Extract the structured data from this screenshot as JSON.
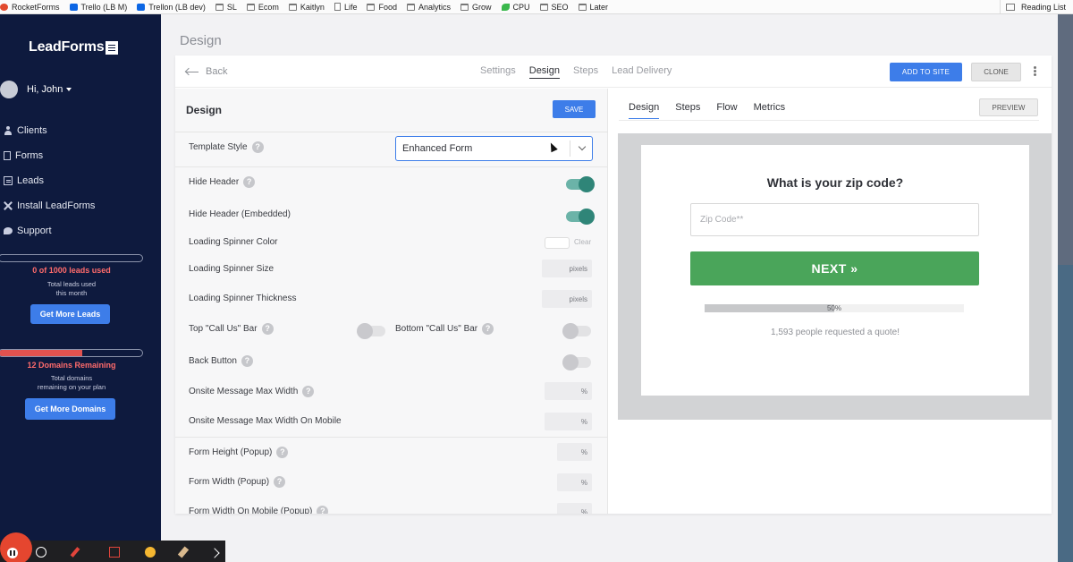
{
  "bookmarks": [
    "RocketForms",
    "Trello (LB M)",
    "Trellon (LB dev)",
    "SL",
    "Ecom",
    "Kaitlyn",
    "Life",
    "Food",
    "Analytics",
    "Grow",
    "CPU",
    "SEO",
    "Later"
  ],
  "reading_list": "Reading List",
  "sidebar": {
    "logo": "LeadForms",
    "user": "Hi, John",
    "nav": [
      "Clients",
      "Forms",
      "Leads",
      "Install LeadForms",
      "Support"
    ],
    "leads_used": "0 of 1000 leads used",
    "leads_sub_1": "Total leads used",
    "leads_sub_2": "this month",
    "get_leads": "Get More Leads",
    "domains_remaining": "12 Domains Remaining",
    "domains_sub_1": "Total domains",
    "domains_sub_2": "remaining on your plan",
    "domains_fill_fraction": 0.58,
    "get_domains": "Get More Domains"
  },
  "page_title": "Design",
  "topbar": {
    "back": "Back",
    "tabs": [
      "Settings",
      "Design",
      "Steps",
      "Lead Delivery"
    ],
    "active_tab": "Design",
    "add_to_site": "ADD TO SITE",
    "clone": "CLONE"
  },
  "left_panel": {
    "title": "Design",
    "save": "SAVE",
    "template_style_label": "Template Style",
    "template_style_value": "Enhanced Form",
    "hide_header": "Hide Header",
    "hide_header_embedded": "Hide Header (Embedded)",
    "spinner_color": "Loading Spinner Color",
    "clear": "Clear",
    "spinner_size": "Loading Spinner Size",
    "spinner_thickness": "Loading Spinner Thickness",
    "pixels": "pixels",
    "top_call_us": "Top \"Call Us\" Bar",
    "bottom_call_us": "Bottom \"Call Us\" Bar",
    "back_button": "Back Button",
    "onsite_max_width": "Onsite Message Max Width",
    "onsite_max_width_mobile": "Onsite Message Max Width On Mobile",
    "percent": "%",
    "form_height_popup": "Form Height (Popup)",
    "form_width_popup": "Form Width (Popup)",
    "form_width_mobile_popup": "Form Width On Mobile (Popup)",
    "help_glyph": "?",
    "toggles": {
      "hide_header": true,
      "hide_header_embedded": true,
      "top_call_us": false,
      "bottom_call_us": false,
      "back_button": false
    }
  },
  "right_panel": {
    "tabs": [
      "Design",
      "Steps",
      "Flow",
      "Metrics"
    ],
    "active_tab": "Design",
    "preview": "PREVIEW",
    "question": "What is your zip code?",
    "zip_placeholder": "Zip Code**",
    "next": "NEXT »",
    "progress_label": "50%",
    "progress_fraction": 0.5,
    "requested": "1,593 people requested a quote!"
  },
  "colors": {
    "sidebar_bg": "#0e1a3e",
    "accent_blue": "#3d7de9",
    "toggle_on": "#2f8578",
    "next_green": "#4aa55a",
    "alert_red": "#ff6b6b"
  }
}
